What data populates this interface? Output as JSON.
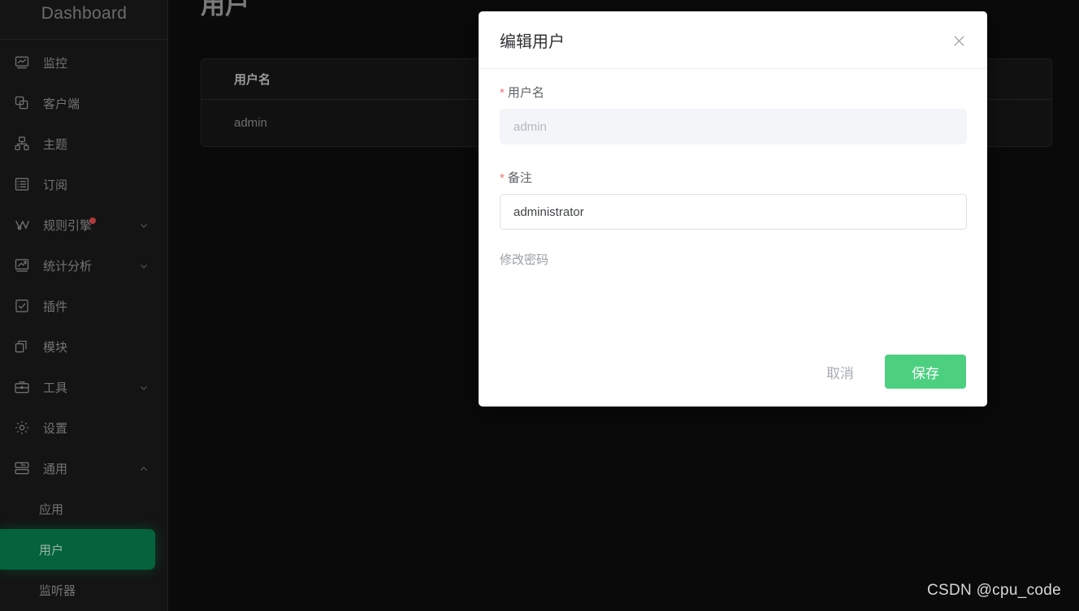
{
  "sidebar": {
    "brand": "Dashboard",
    "items": [
      {
        "label": "监控",
        "icon": "monitor-icon",
        "expandable": false
      },
      {
        "label": "客户端",
        "icon": "clients-icon",
        "expandable": false
      },
      {
        "label": "主题",
        "icon": "topic-icon",
        "expandable": false
      },
      {
        "label": "订阅",
        "icon": "subscription-icon",
        "expandable": false
      },
      {
        "label": "规则引擎",
        "icon": "rule-engine-icon",
        "expandable": true,
        "badge": true
      },
      {
        "label": "统计分析",
        "icon": "analytics-icon",
        "expandable": true
      },
      {
        "label": "插件",
        "icon": "plugin-icon",
        "expandable": false
      },
      {
        "label": "模块",
        "icon": "module-icon",
        "expandable": false
      },
      {
        "label": "工具",
        "icon": "tools-icon",
        "expandable": true
      },
      {
        "label": "设置",
        "icon": "settings-icon",
        "expandable": false
      },
      {
        "label": "通用",
        "icon": "general-icon",
        "expandable": true,
        "expanded": true
      }
    ],
    "sub_items": [
      {
        "label": "应用",
        "active": false
      },
      {
        "label": "用户",
        "active": true
      },
      {
        "label": "监听器",
        "active": false
      }
    ],
    "active_color": "#04633d"
  },
  "main": {
    "page_title": "用户",
    "table": {
      "columns": [
        "用户名"
      ],
      "rows": [
        [
          "admin"
        ]
      ]
    }
  },
  "modal": {
    "title": "编辑用户",
    "close_icon": "close-icon",
    "fields": {
      "username": {
        "label": "用户名",
        "required": true,
        "value": "admin",
        "disabled": true
      },
      "remark": {
        "label": "备注",
        "required": true,
        "value": "administrator",
        "disabled": false
      }
    },
    "change_password_link": "修改密码",
    "cancel_label": "取消",
    "save_label": "保存",
    "save_color": "#4cd080"
  },
  "watermark": "CSDN @cpu_code"
}
